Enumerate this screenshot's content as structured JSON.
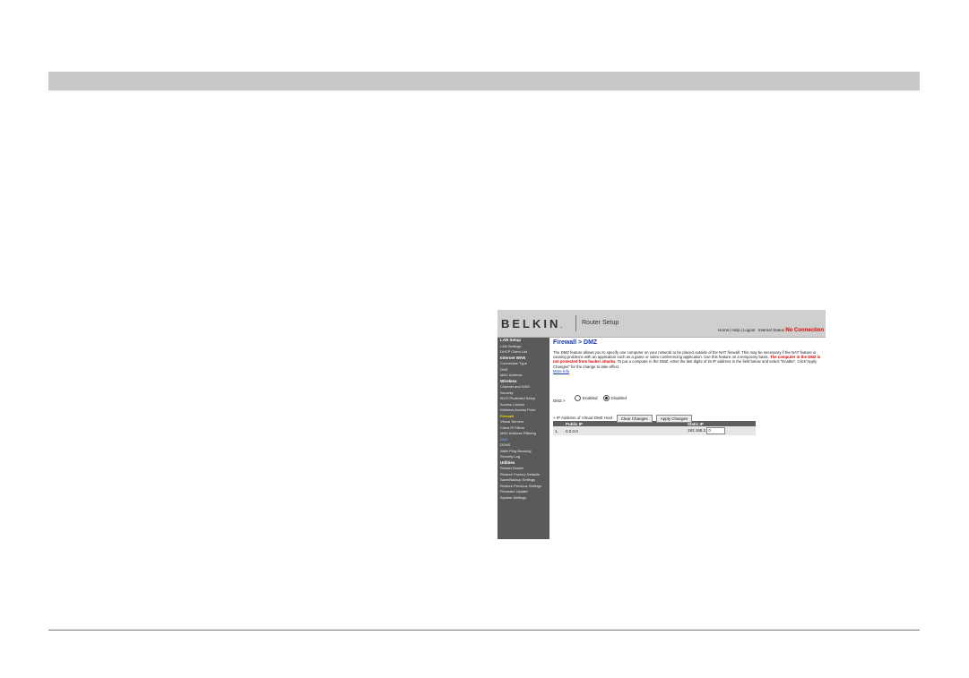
{
  "header": {
    "brand": "BELKIN",
    "brand_mark": ".",
    "title": "Router Setup",
    "links": [
      "Home",
      "Help",
      "Logout"
    ],
    "status_label": "Internet Status",
    "status_value": "No Connection"
  },
  "sidebar": {
    "items": [
      {
        "label": "LAN Setup",
        "type": "head"
      },
      {
        "label": "LAN Settings",
        "type": "item"
      },
      {
        "label": "DHCP Client List",
        "type": "item"
      },
      {
        "label": "Internet WAN",
        "type": "head"
      },
      {
        "label": "Connection Type",
        "type": "item"
      },
      {
        "label": "DNS",
        "type": "item"
      },
      {
        "label": "MAC Address",
        "type": "item"
      },
      {
        "label": "Wireless",
        "type": "head"
      },
      {
        "label": "Channel and SSID",
        "type": "item"
      },
      {
        "label": "Security",
        "type": "item"
      },
      {
        "label": "Wi-Fi Protected Setup",
        "type": "item"
      },
      {
        "label": "Access Control",
        "type": "item"
      },
      {
        "label": "Wireless Access Point",
        "type": "item"
      },
      {
        "label": "Firewall",
        "type": "current"
      },
      {
        "label": "Virtual Servers",
        "type": "item"
      },
      {
        "label": "Client IP Filters",
        "type": "item"
      },
      {
        "label": "MAC Address Filtering",
        "type": "item"
      },
      {
        "label": "DMZ",
        "type": "active"
      },
      {
        "label": "DDNS",
        "type": "item"
      },
      {
        "label": "WAN Ping Blocking",
        "type": "item"
      },
      {
        "label": "Security Log",
        "type": "item"
      },
      {
        "label": "Utilities",
        "type": "head"
      },
      {
        "label": "Restart Router",
        "type": "item"
      },
      {
        "label": "Restore Factory Defaults",
        "type": "item"
      },
      {
        "label": "Save/Backup Settings",
        "type": "item"
      },
      {
        "label": "Restore Previous Settings",
        "type": "item"
      },
      {
        "label": "Firmware Update",
        "type": "item"
      },
      {
        "label": "System Settings",
        "type": "item"
      }
    ]
  },
  "main": {
    "breadcrumb": "Firewall > DMZ",
    "desc_part1": "The DMZ feature allows you to specify one computer on your network to be placed outside of the NAT firewall. This may be necessary if the NAT feature is causing problems with an application such as a game or video conferencing application. Use this feature on a temporary basis. ",
    "desc_warning": "The computer in the DMZ is not protected from hacker attacks.",
    "desc_part2": " To put a computer in the DMZ, enter the last digits of its IP address in the field below and select \"Enable\". Click\"Apply Changes\" for the change to take effect.",
    "more_info": "More Info",
    "dmz_label": "DMZ >",
    "radio_enabled": "Enabled",
    "radio_disabled": "Disabled",
    "dmz_selected": "Disabled",
    "section_label": "> IP Address of Virtual DMZ Host",
    "table": {
      "headers": [
        "",
        "Public IP",
        "Static IP"
      ],
      "rows": [
        {
          "index": "1.",
          "public_ip": "0.0.0.0",
          "static_prefix": "192.168.2.",
          "static_value": "0"
        }
      ]
    },
    "btn_clear": "Clear Changes",
    "btn_apply": "Apply Changes"
  }
}
